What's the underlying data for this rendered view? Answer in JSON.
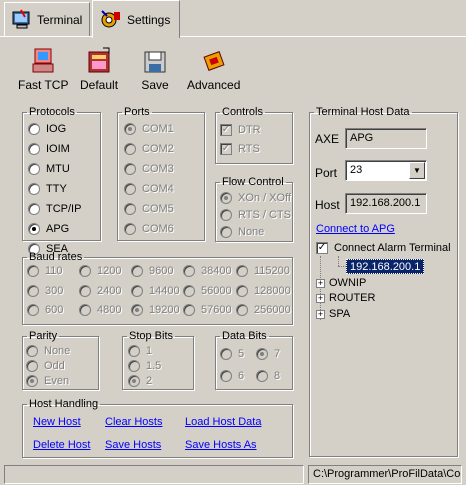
{
  "tabs": [
    {
      "label": "Terminal",
      "icon": "terminal-icon"
    },
    {
      "label": "Settings",
      "icon": "settings-icon"
    }
  ],
  "toolbar": {
    "fast_tcp": "Fast TCP",
    "default": "Default",
    "save": "Save",
    "advanced": "Advanced"
  },
  "protocols": {
    "title": "Protocols",
    "items": [
      "IOG",
      "IOIM",
      "MTU",
      "TTY",
      "TCP/IP",
      "APG",
      "SEA"
    ],
    "selected": "APG"
  },
  "ports": {
    "title": "Ports",
    "items": [
      "COM1",
      "COM2",
      "COM3",
      "COM4",
      "COM5",
      "COM6"
    ],
    "selected": "COM1"
  },
  "controls": {
    "title": "Controls",
    "dtr": "DTR",
    "rts": "RTS"
  },
  "flow_control": {
    "title": "Flow Control",
    "items": [
      "XOn / XOff",
      "RTS / CTS",
      "None"
    ],
    "selected": "XOn / XOff"
  },
  "baud_rates": {
    "title": "Baud rates",
    "rows": [
      [
        "110",
        "1200",
        "9600",
        "38400",
        "115200"
      ],
      [
        "300",
        "2400",
        "14400",
        "56000",
        "128000"
      ],
      [
        "600",
        "4800",
        "19200",
        "57600",
        "256000"
      ]
    ],
    "selected": "19200"
  },
  "parity": {
    "title": "Parity",
    "items": [
      "None",
      "Odd",
      "Even"
    ],
    "selected": "Even"
  },
  "stop_bits": {
    "title": "Stop Bits",
    "items": [
      "1",
      "1.5",
      "2"
    ],
    "selected": "2"
  },
  "data_bits": {
    "title": "Data Bits",
    "items": [
      "5",
      "7",
      "6",
      "8"
    ],
    "selected": "7"
  },
  "host_handling": {
    "title": "Host Handling",
    "new_host": "New Host",
    "clear_hosts": "Clear Hosts",
    "load_host_data": "Load Host Data",
    "delete_host": "Delete Host",
    "save_hosts": "Save Hosts",
    "save_hosts_as": "Save Hosts As"
  },
  "terminal_host": {
    "title": "Terminal Host Data",
    "axe_label": "AXE",
    "axe_value": "APG",
    "port_label": "Port",
    "port_value": "23",
    "host_label": "Host",
    "host_value": "192.168.200.1",
    "connect_link": "Connect to APG",
    "connect_alarm": "Connect Alarm Terminal",
    "alarm_ip": "192.168.200.1",
    "tree": [
      "OWNIP",
      "ROUTER",
      "SPA"
    ]
  },
  "status": {
    "path": "C:\\Programmer\\ProFilData\\Con"
  }
}
